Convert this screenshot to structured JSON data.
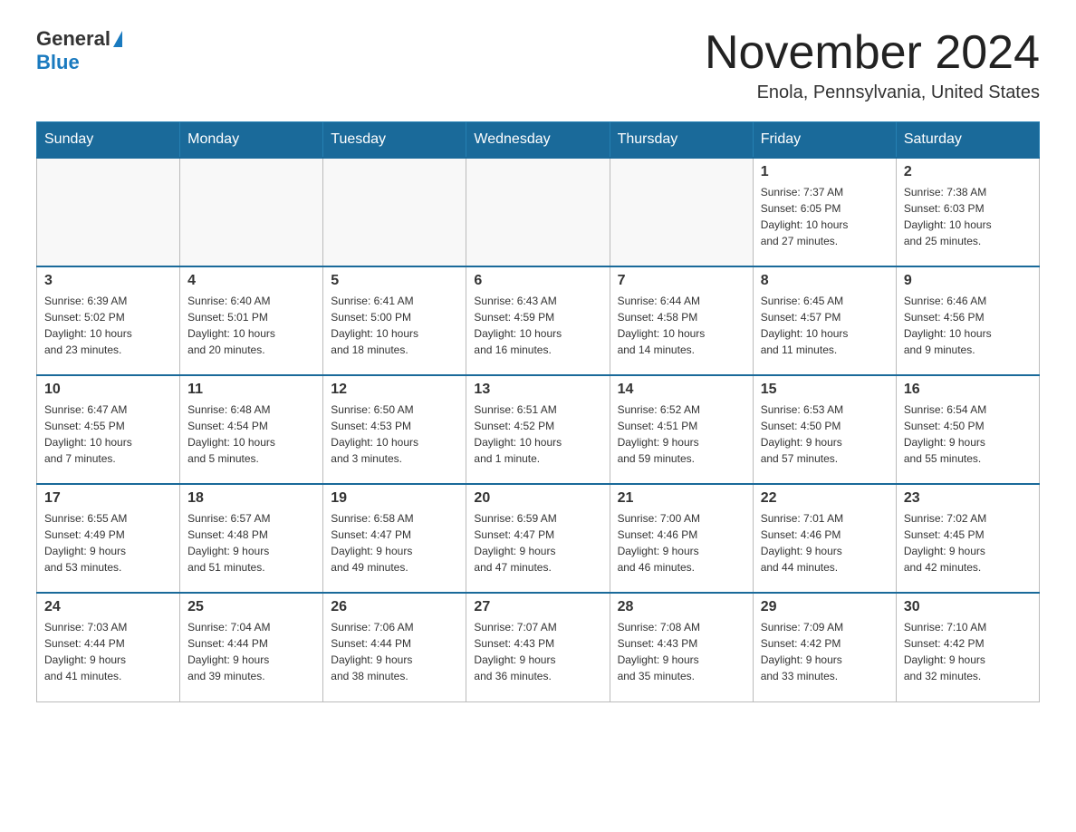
{
  "header": {
    "logo_general": "General",
    "logo_blue": "Blue",
    "month_title": "November 2024",
    "location": "Enola, Pennsylvania, United States"
  },
  "weekdays": [
    "Sunday",
    "Monday",
    "Tuesday",
    "Wednesday",
    "Thursday",
    "Friday",
    "Saturday"
  ],
  "weeks": [
    [
      {
        "day": "",
        "info": ""
      },
      {
        "day": "",
        "info": ""
      },
      {
        "day": "",
        "info": ""
      },
      {
        "day": "",
        "info": ""
      },
      {
        "day": "",
        "info": ""
      },
      {
        "day": "1",
        "info": "Sunrise: 7:37 AM\nSunset: 6:05 PM\nDaylight: 10 hours\nand 27 minutes."
      },
      {
        "day": "2",
        "info": "Sunrise: 7:38 AM\nSunset: 6:03 PM\nDaylight: 10 hours\nand 25 minutes."
      }
    ],
    [
      {
        "day": "3",
        "info": "Sunrise: 6:39 AM\nSunset: 5:02 PM\nDaylight: 10 hours\nand 23 minutes."
      },
      {
        "day": "4",
        "info": "Sunrise: 6:40 AM\nSunset: 5:01 PM\nDaylight: 10 hours\nand 20 minutes."
      },
      {
        "day": "5",
        "info": "Sunrise: 6:41 AM\nSunset: 5:00 PM\nDaylight: 10 hours\nand 18 minutes."
      },
      {
        "day": "6",
        "info": "Sunrise: 6:43 AM\nSunset: 4:59 PM\nDaylight: 10 hours\nand 16 minutes."
      },
      {
        "day": "7",
        "info": "Sunrise: 6:44 AM\nSunset: 4:58 PM\nDaylight: 10 hours\nand 14 minutes."
      },
      {
        "day": "8",
        "info": "Sunrise: 6:45 AM\nSunset: 4:57 PM\nDaylight: 10 hours\nand 11 minutes."
      },
      {
        "day": "9",
        "info": "Sunrise: 6:46 AM\nSunset: 4:56 PM\nDaylight: 10 hours\nand 9 minutes."
      }
    ],
    [
      {
        "day": "10",
        "info": "Sunrise: 6:47 AM\nSunset: 4:55 PM\nDaylight: 10 hours\nand 7 minutes."
      },
      {
        "day": "11",
        "info": "Sunrise: 6:48 AM\nSunset: 4:54 PM\nDaylight: 10 hours\nand 5 minutes."
      },
      {
        "day": "12",
        "info": "Sunrise: 6:50 AM\nSunset: 4:53 PM\nDaylight: 10 hours\nand 3 minutes."
      },
      {
        "day": "13",
        "info": "Sunrise: 6:51 AM\nSunset: 4:52 PM\nDaylight: 10 hours\nand 1 minute."
      },
      {
        "day": "14",
        "info": "Sunrise: 6:52 AM\nSunset: 4:51 PM\nDaylight: 9 hours\nand 59 minutes."
      },
      {
        "day": "15",
        "info": "Sunrise: 6:53 AM\nSunset: 4:50 PM\nDaylight: 9 hours\nand 57 minutes."
      },
      {
        "day": "16",
        "info": "Sunrise: 6:54 AM\nSunset: 4:50 PM\nDaylight: 9 hours\nand 55 minutes."
      }
    ],
    [
      {
        "day": "17",
        "info": "Sunrise: 6:55 AM\nSunset: 4:49 PM\nDaylight: 9 hours\nand 53 minutes."
      },
      {
        "day": "18",
        "info": "Sunrise: 6:57 AM\nSunset: 4:48 PM\nDaylight: 9 hours\nand 51 minutes."
      },
      {
        "day": "19",
        "info": "Sunrise: 6:58 AM\nSunset: 4:47 PM\nDaylight: 9 hours\nand 49 minutes."
      },
      {
        "day": "20",
        "info": "Sunrise: 6:59 AM\nSunset: 4:47 PM\nDaylight: 9 hours\nand 47 minutes."
      },
      {
        "day": "21",
        "info": "Sunrise: 7:00 AM\nSunset: 4:46 PM\nDaylight: 9 hours\nand 46 minutes."
      },
      {
        "day": "22",
        "info": "Sunrise: 7:01 AM\nSunset: 4:46 PM\nDaylight: 9 hours\nand 44 minutes."
      },
      {
        "day": "23",
        "info": "Sunrise: 7:02 AM\nSunset: 4:45 PM\nDaylight: 9 hours\nand 42 minutes."
      }
    ],
    [
      {
        "day": "24",
        "info": "Sunrise: 7:03 AM\nSunset: 4:44 PM\nDaylight: 9 hours\nand 41 minutes."
      },
      {
        "day": "25",
        "info": "Sunrise: 7:04 AM\nSunset: 4:44 PM\nDaylight: 9 hours\nand 39 minutes."
      },
      {
        "day": "26",
        "info": "Sunrise: 7:06 AM\nSunset: 4:44 PM\nDaylight: 9 hours\nand 38 minutes."
      },
      {
        "day": "27",
        "info": "Sunrise: 7:07 AM\nSunset: 4:43 PM\nDaylight: 9 hours\nand 36 minutes."
      },
      {
        "day": "28",
        "info": "Sunrise: 7:08 AM\nSunset: 4:43 PM\nDaylight: 9 hours\nand 35 minutes."
      },
      {
        "day": "29",
        "info": "Sunrise: 7:09 AM\nSunset: 4:42 PM\nDaylight: 9 hours\nand 33 minutes."
      },
      {
        "day": "30",
        "info": "Sunrise: 7:10 AM\nSunset: 4:42 PM\nDaylight: 9 hours\nand 32 minutes."
      }
    ]
  ]
}
